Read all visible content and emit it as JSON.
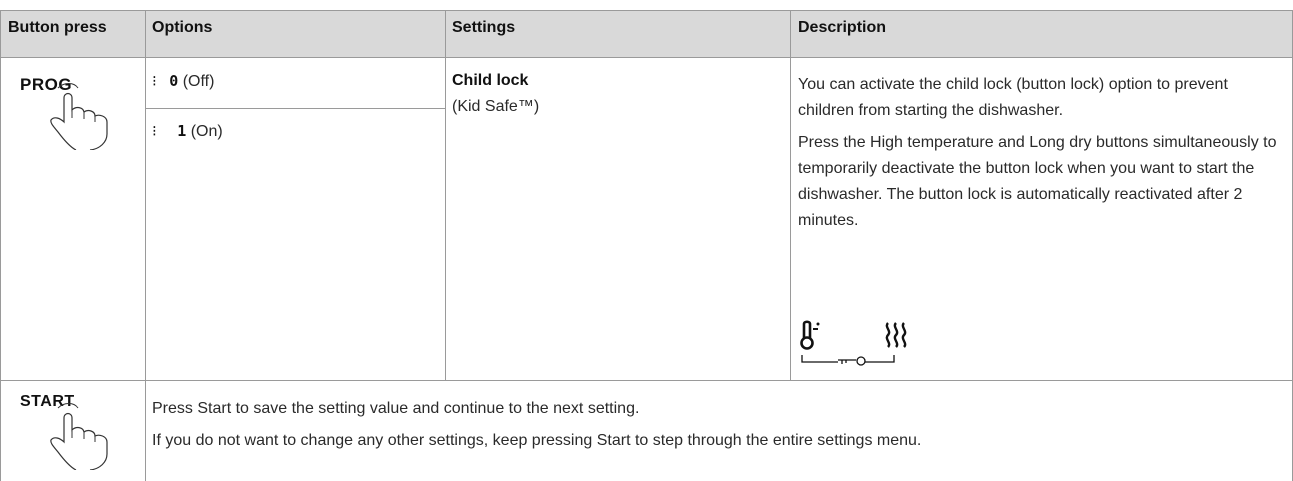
{
  "table": {
    "headers": {
      "button_press": "Button press",
      "options": "Options",
      "settings": "Settings",
      "description": "Description"
    },
    "row1": {
      "button_label": "PROG",
      "options": [
        {
          "indicator": "⁝",
          "digit": "0",
          "label": "(Off)"
        },
        {
          "indicator": "⁝",
          "digit": "1",
          "label": "(On)"
        }
      ],
      "setting_title": "Child lock",
      "setting_subtitle": "(Kid Safe™)",
      "description": [
        "You can activate the child lock (button lock) option to prevent children from starting the dishwasher.",
        "Press the High temperature and Long dry buttons simultaneously to temporarily deactivate the button lock when you want to start the dishwasher. The button lock is automatically reactivated after 2 minutes."
      ],
      "icons": [
        "thermometer-icon",
        "steam-icon",
        "key-icon"
      ]
    },
    "row2": {
      "button_label": "START",
      "lines": [
        "Press Start to save the setting value and continue to the next setting.",
        "If you do not want to change any other settings, keep pressing Start to step through the entire settings menu."
      ]
    }
  },
  "colors": {
    "header_bg": "#d9d9d9",
    "border": "#9a9a9a",
    "text": "#2a2a2a"
  }
}
